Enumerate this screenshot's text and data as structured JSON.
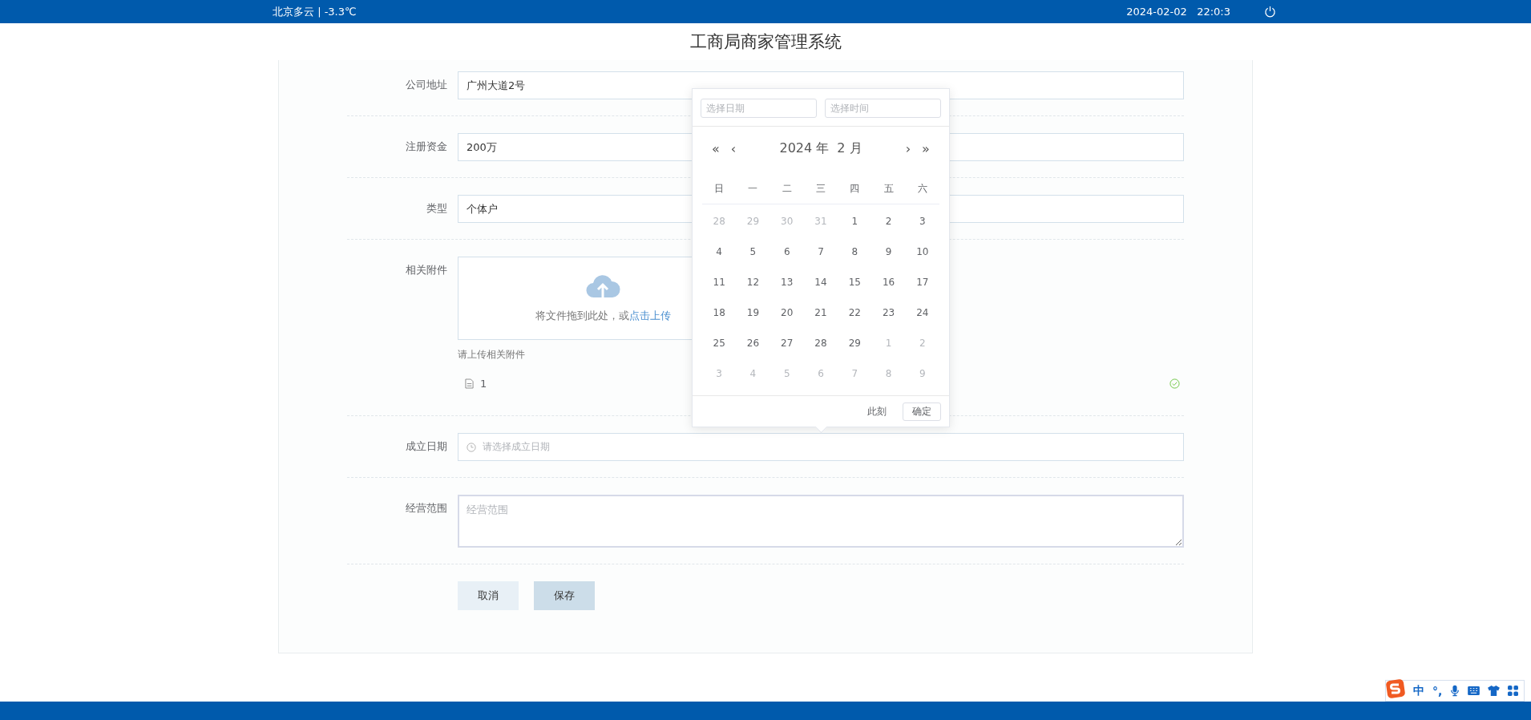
{
  "top_bar": {
    "weather": "北京多云 | -3.3℃",
    "datetime": "2024-02-02   22:0:3"
  },
  "header": {
    "title": "工商局商家管理系统"
  },
  "form": {
    "fields": [
      {
        "kind": "input",
        "label": "公司地址",
        "value": "广州大道2号"
      },
      {
        "kind": "input",
        "label": "注册资金",
        "value": "200万"
      },
      {
        "kind": "input",
        "label": "类型",
        "value": "个体户"
      },
      {
        "kind": "upload",
        "label": "相关附件",
        "drop_text": "将文件拖到此处，或",
        "drop_link": "点击上传",
        "tip": "请上传相关附件",
        "files": [
          {
            "name": "1",
            "uploaded": true
          }
        ]
      },
      {
        "kind": "date",
        "label": "成立日期",
        "placeholder": "请选择成立日期"
      },
      {
        "kind": "textarea",
        "label": "经营范围",
        "placeholder": "经营范围"
      }
    ],
    "buttons": [
      {
        "label": "取消",
        "kind": "cancel"
      },
      {
        "label": "保存",
        "kind": "save"
      }
    ]
  },
  "date_picker": {
    "date_placeholder": "选择日期",
    "time_placeholder": "选择时间",
    "nav": {
      "prev_year": "«",
      "prev_month": "‹",
      "next_month": "›",
      "next_year": "»"
    },
    "year_label": "2024 年",
    "month_label": "2 月",
    "weekdays": [
      "日",
      "一",
      "二",
      "三",
      "四",
      "五",
      "六"
    ],
    "days": [
      {
        "label": "28",
        "in_month": false
      },
      {
        "label": "29",
        "in_month": false
      },
      {
        "label": "30",
        "in_month": false
      },
      {
        "label": "31",
        "in_month": false
      },
      {
        "label": "1",
        "in_month": true
      },
      {
        "label": "2",
        "in_month": true
      },
      {
        "label": "3",
        "in_month": true
      },
      {
        "label": "4",
        "in_month": true
      },
      {
        "label": "5",
        "in_month": true
      },
      {
        "label": "6",
        "in_month": true
      },
      {
        "label": "7",
        "in_month": true
      },
      {
        "label": "8",
        "in_month": true
      },
      {
        "label": "9",
        "in_month": true
      },
      {
        "label": "10",
        "in_month": true
      },
      {
        "label": "11",
        "in_month": true
      },
      {
        "label": "12",
        "in_month": true
      },
      {
        "label": "13",
        "in_month": true
      },
      {
        "label": "14",
        "in_month": true
      },
      {
        "label": "15",
        "in_month": true
      },
      {
        "label": "16",
        "in_month": true
      },
      {
        "label": "17",
        "in_month": true
      },
      {
        "label": "18",
        "in_month": true
      },
      {
        "label": "19",
        "in_month": true
      },
      {
        "label": "20",
        "in_month": true
      },
      {
        "label": "21",
        "in_month": true
      },
      {
        "label": "22",
        "in_month": true
      },
      {
        "label": "23",
        "in_month": true
      },
      {
        "label": "24",
        "in_month": true
      },
      {
        "label": "25",
        "in_month": true
      },
      {
        "label": "26",
        "in_month": true
      },
      {
        "label": "27",
        "in_month": true
      },
      {
        "label": "28",
        "in_month": true
      },
      {
        "label": "29",
        "in_month": true
      },
      {
        "label": "1",
        "in_month": false
      },
      {
        "label": "2",
        "in_month": false
      },
      {
        "label": "3",
        "in_month": false
      },
      {
        "label": "4",
        "in_month": false
      },
      {
        "label": "5",
        "in_month": false
      },
      {
        "label": "6",
        "in_month": false
      },
      {
        "label": "7",
        "in_month": false
      },
      {
        "label": "8",
        "in_month": false
      },
      {
        "label": "9",
        "in_month": false
      }
    ],
    "footer": {
      "now": "此刻",
      "confirm": "确定"
    }
  },
  "ime": {
    "labels": [
      "中",
      "°,"
    ]
  }
}
